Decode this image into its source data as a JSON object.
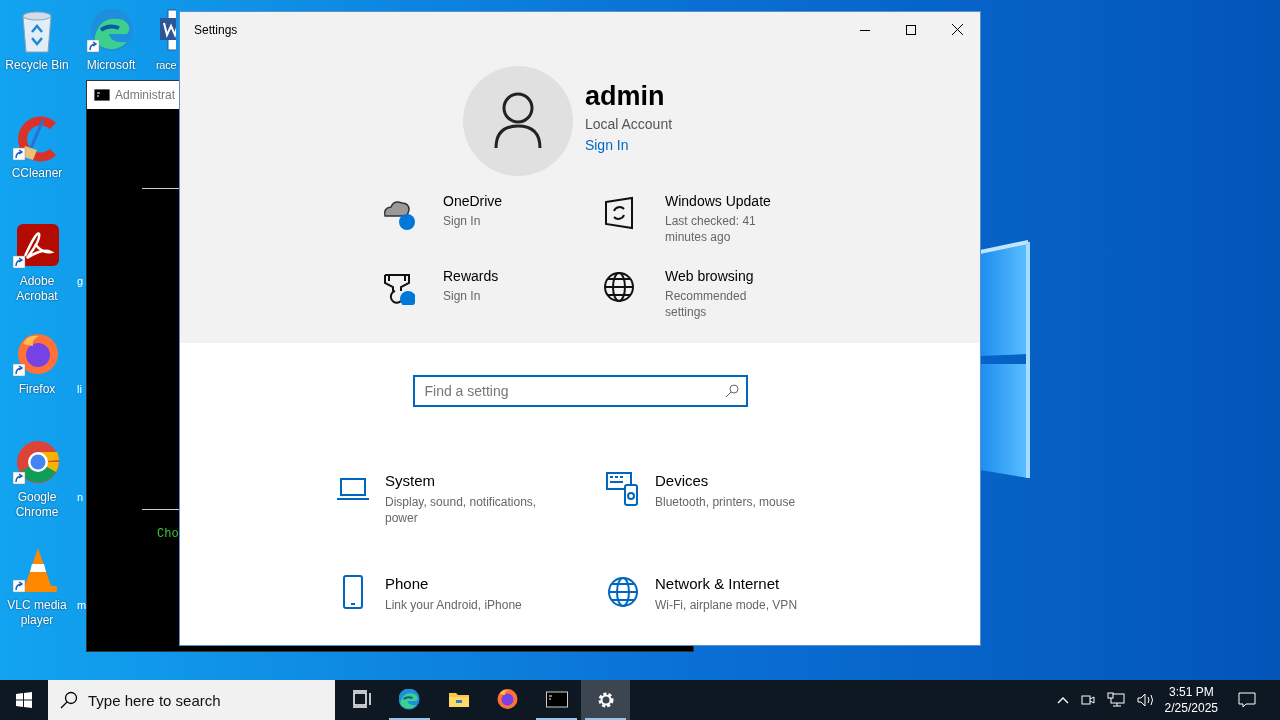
{
  "desktop_icons": [
    {
      "label": "Recycle Bin",
      "kind": "recycle",
      "shortcut": false
    },
    {
      "label": "CCleaner",
      "kind": "ccleaner",
      "shortcut": true
    },
    {
      "label": "Adobe Acrobat",
      "kind": "acrobat",
      "shortcut": true
    },
    {
      "label": "Firefox",
      "kind": "firefox",
      "shortcut": true
    },
    {
      "label": "Google Chrome",
      "kind": "chrome",
      "shortcut": true
    },
    {
      "label": "VLC media player",
      "kind": "vlc",
      "shortcut": true
    }
  ],
  "desktop_top_row": [
    {
      "label": "Microsoft",
      "kind": "edge",
      "shortcut": true
    },
    {
      "label": "race",
      "kind": "word",
      "shortcut": false
    }
  ],
  "desktop_peek_labels": [
    "g",
    "li",
    "n",
    "m"
  ],
  "cmd_window": {
    "title": "Administrat",
    "lines": [
      "Cho"
    ]
  },
  "settings": {
    "title": "Settings",
    "account": {
      "name": "admin",
      "type": "Local Account",
      "link": "Sign In"
    },
    "tiles": [
      {
        "title": "OneDrive",
        "subtitle": "Sign In",
        "kind": "onedrive"
      },
      {
        "title": "Windows Update",
        "subtitle": "Last checked: 41 minutes ago",
        "kind": "update"
      },
      {
        "title": "Rewards",
        "subtitle": "Sign In",
        "kind": "rewards"
      },
      {
        "title": "Web browsing",
        "subtitle": "Recommended settings",
        "kind": "globe"
      }
    ],
    "search": {
      "placeholder": "Find a setting"
    },
    "categories": [
      {
        "title": "System",
        "subtitle": "Display, sound, notifications, power",
        "kind": "laptop"
      },
      {
        "title": "Devices",
        "subtitle": "Bluetooth, printers, mouse",
        "kind": "devices"
      },
      {
        "title": "Phone",
        "subtitle": "Link your Android, iPhone",
        "kind": "phone"
      },
      {
        "title": "Network & Internet",
        "subtitle": "Wi-Fi, airplane mode, VPN",
        "kind": "globe"
      }
    ]
  },
  "taskbar": {
    "search_placeholder": "Type here to search",
    "apps": [
      {
        "kind": "taskview",
        "running": false,
        "active": false
      },
      {
        "kind": "edge",
        "running": true,
        "active": false
      },
      {
        "kind": "explorer",
        "running": false,
        "active": false
      },
      {
        "kind": "firefox",
        "running": false,
        "active": false
      },
      {
        "kind": "cmd",
        "running": true,
        "active": false
      },
      {
        "kind": "settings",
        "running": true,
        "active": true
      }
    ],
    "time": "3:51 PM",
    "date": "2/25/2025"
  }
}
